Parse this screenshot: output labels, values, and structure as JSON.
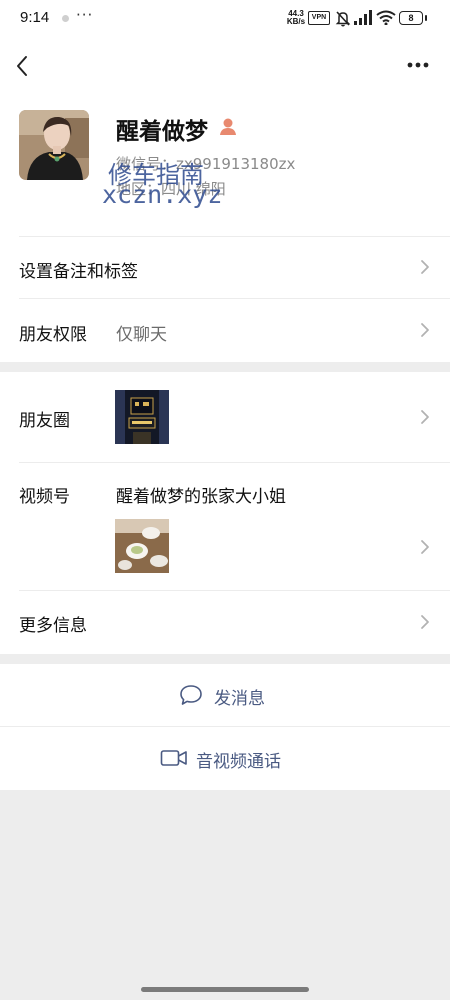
{
  "status_bar": {
    "time": "9:14",
    "more": "···",
    "net_speed_value": "44.3",
    "net_speed_unit": "KB/s",
    "vpn": "VPN",
    "battery": "8"
  },
  "profile": {
    "name": "醒着做梦",
    "wechat_id": "微信号：zx991913180zx",
    "region": "地区：四川 绵阳"
  },
  "watermark": {
    "cn": "修车指南",
    "en": "xczn.xyz"
  },
  "rows": {
    "remarks_label": "设置备注和标签",
    "permissions_label": "朋友权限",
    "permissions_value": "仅聊天",
    "moments_label": "朋友圈",
    "channels_label": "视频号",
    "channels_name": "醒着做梦的张家大小姐",
    "more_info_label": "更多信息"
  },
  "actions": {
    "message": "发消息",
    "av_call": "音视频通话"
  },
  "colors": {
    "background": "#ededed",
    "card": "#ffffff",
    "link_blue": "#4a5a82",
    "muted_text": "#8a8a8a",
    "gender_icon": "#e8896f"
  },
  "icons": [
    "back-arrow-icon",
    "more-dots-icon",
    "mute-bell-icon",
    "signal-icon",
    "wifi-icon",
    "chat-bubble-icon",
    "video-camera-icon",
    "chevron-right-icon",
    "gender-female-icon"
  ]
}
